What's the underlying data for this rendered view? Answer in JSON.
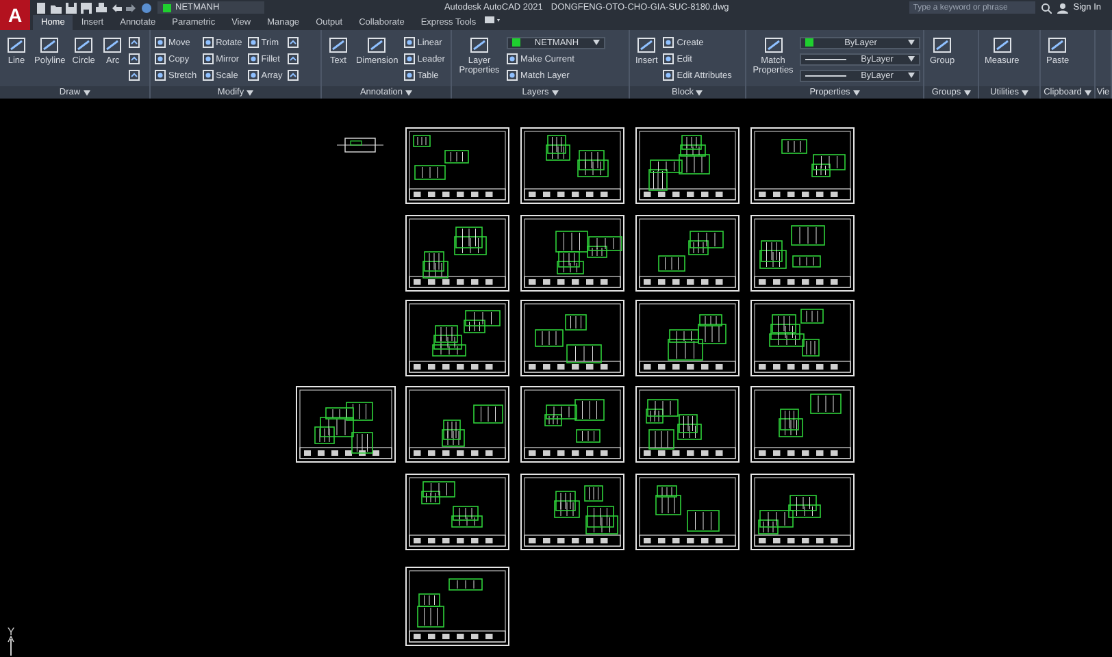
{
  "app": {
    "logo": "A",
    "title": "Autodesk AutoCAD 2021",
    "file": "DONGFENG-OTO-CHO-GIA-SUC-8180.dwg"
  },
  "quick_access": {
    "layer": "NETMANH"
  },
  "search": {
    "placeholder": "Type a keyword or phrase"
  },
  "account": {
    "label": "Sign In"
  },
  "tabs": [
    {
      "label": "Home",
      "selected": true
    },
    {
      "label": "Insert",
      "selected": false
    },
    {
      "label": "Annotate",
      "selected": false
    },
    {
      "label": "Parametric",
      "selected": false
    },
    {
      "label": "View",
      "selected": false
    },
    {
      "label": "Manage",
      "selected": false
    },
    {
      "label": "Output",
      "selected": false
    },
    {
      "label": "Collaborate",
      "selected": false
    },
    {
      "label": "Express Tools",
      "selected": false
    }
  ],
  "panels": [
    {
      "title": "Draw",
      "tools": [
        {
          "kind": "large",
          "label": "Line"
        },
        {
          "kind": "large",
          "label": "Polyline"
        },
        {
          "kind": "large",
          "label": "Circle"
        },
        {
          "kind": "large",
          "label": "Arc"
        },
        {
          "kind": "icon"
        },
        {
          "kind": "icon"
        },
        {
          "kind": "icon"
        }
      ]
    },
    {
      "title": "Modify",
      "tools": [
        {
          "kind": "small",
          "label": "Move"
        },
        {
          "kind": "small",
          "label": "Copy"
        },
        {
          "kind": "small",
          "label": "Stretch"
        },
        {
          "kind": "small",
          "label": "Rotate"
        },
        {
          "kind": "small",
          "label": "Mirror"
        },
        {
          "kind": "small",
          "label": "Scale"
        },
        {
          "kind": "small",
          "label": "Trim"
        },
        {
          "kind": "small",
          "label": "Fillet"
        },
        {
          "kind": "small",
          "label": "Array"
        },
        {
          "kind": "icon"
        },
        {
          "kind": "icon"
        },
        {
          "kind": "icon"
        }
      ]
    },
    {
      "title": "Annotation",
      "tools": [
        {
          "kind": "large",
          "label": "Text"
        },
        {
          "kind": "large",
          "label": "Dimension"
        },
        {
          "kind": "small",
          "label": "Linear"
        },
        {
          "kind": "small",
          "label": "Leader"
        },
        {
          "kind": "small",
          "label": "Table"
        }
      ]
    },
    {
      "title": "Layers",
      "tools": [
        {
          "kind": "large",
          "label": "Layer Properties"
        },
        {
          "kind": "layer-dropdown",
          "label": "NETMANH"
        },
        {
          "kind": "small",
          "label": "Make Current"
        },
        {
          "kind": "small",
          "label": "Match Layer"
        }
      ]
    },
    {
      "title": "Block",
      "tools": [
        {
          "kind": "large",
          "label": "Insert"
        },
        {
          "kind": "small",
          "label": "Create"
        },
        {
          "kind": "small",
          "label": "Edit"
        },
        {
          "kind": "small",
          "label": "Edit Attributes"
        }
      ]
    },
    {
      "title": "Properties",
      "tools": [
        {
          "kind": "large",
          "label": "Match Properties"
        },
        {
          "kind": "color-dropdown",
          "label": "ByLayer"
        },
        {
          "kind": "line-dropdown",
          "label": "ByLayer"
        },
        {
          "kind": "line-dropdown",
          "label": "ByLayer"
        }
      ]
    },
    {
      "title": "Groups",
      "tools": [
        {
          "kind": "large",
          "label": "Group"
        }
      ]
    },
    {
      "title": "Utilities",
      "tools": [
        {
          "kind": "large",
          "label": "Measure"
        }
      ]
    },
    {
      "title": "Clipboard",
      "tools": [
        {
          "kind": "large",
          "label": "Paste"
        }
      ]
    },
    {
      "title": "Vie"
    }
  ],
  "ucs_label": "Y"
}
